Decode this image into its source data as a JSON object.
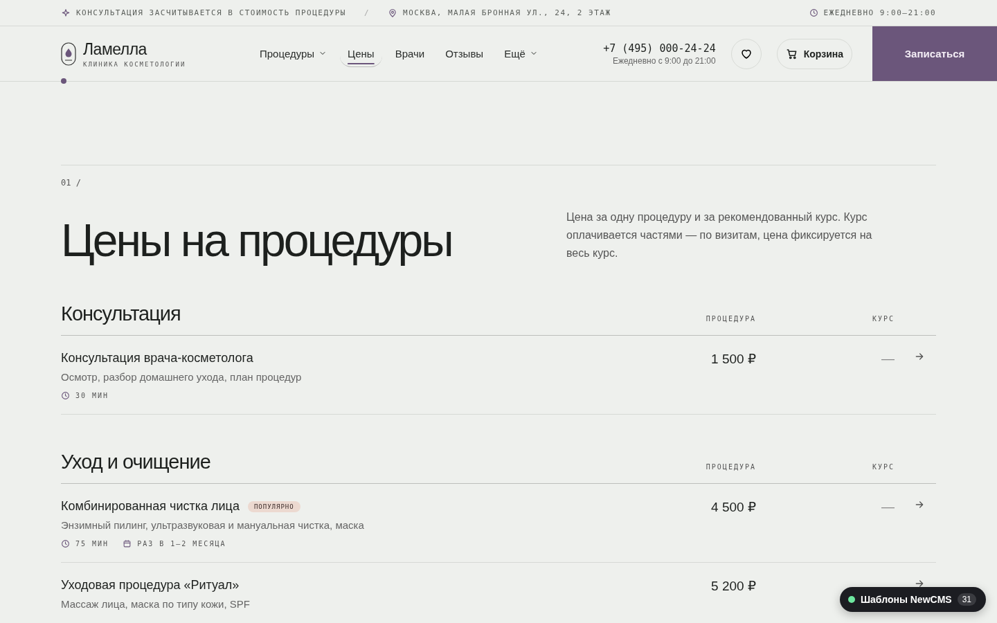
{
  "topbar": {
    "promo": "КОНСУЛЬТАЦИЯ ЗАСЧИТЫВАЕТСЯ В СТОИМОСТЬ ПРОЦЕДУРЫ",
    "separator": "/",
    "address": "МОСКВА, МАЛАЯ БРОННАЯ УЛ., 24, 2 ЭТАЖ",
    "hours": "ЕЖЕДНЕВНО 9:00–21:00"
  },
  "header": {
    "logo": {
      "name": "Ламелла",
      "tagline": "КЛИНИКА КОСМЕТОЛОГИИ"
    },
    "nav": [
      {
        "label": "Процедуры",
        "dropdown": true,
        "selected": false
      },
      {
        "label": "Цены",
        "dropdown": false,
        "selected": true
      },
      {
        "label": "Врачи",
        "dropdown": false,
        "selected": false
      },
      {
        "label": "Отзывы",
        "dropdown": false,
        "selected": false
      },
      {
        "label": "Ещё",
        "dropdown": true,
        "selected": false
      }
    ],
    "phone": "+7 (495) 000-24-24",
    "phone_hours": "Ежедневно с 9:00 до 21:00",
    "cart": "Корзина",
    "cta": "Записаться"
  },
  "section": {
    "number": "01 /",
    "title": "Цены на процедуры",
    "intro": "Цена за одну процедуру и за рекомендованный курс. Курс оплачивается частями — по визитам, цена фиксируется на весь курс."
  },
  "groups": [
    {
      "title": "Консультация",
      "col_procedure": "ПРОЦЕДУРА",
      "col_course": "КУРС",
      "items": [
        {
          "name": "Консультация врача-косметолога",
          "description": "Осмотр, разбор домашнего ухода, план процедур",
          "duration": "30 МИН",
          "price": "1 500 ₽",
          "course": "—"
        }
      ]
    },
    {
      "title": "Уход и очищение",
      "col_procedure": "ПРОЦЕДУРА",
      "col_course": "КУРС",
      "items": [
        {
          "name": "Комбинированная чистка лица",
          "badge": "ПОПУЛЯРНО",
          "description": "Энзимный пилинг, ультразвуковая и мануальная чистка, маска",
          "duration": "75 МИН",
          "frequency": "РАЗ В 1–2 МЕСЯЦА",
          "price": "4 500 ₽",
          "course": "—"
        },
        {
          "name": "Уходовая процедура «Ритуал»",
          "description": "Массаж лица, маска по типу кожи, SPF",
          "price": "5 200 ₽"
        }
      ]
    }
  ],
  "floating_badge": {
    "label": "Шаблоны NewCMS",
    "count": "31",
    "online": true
  }
}
